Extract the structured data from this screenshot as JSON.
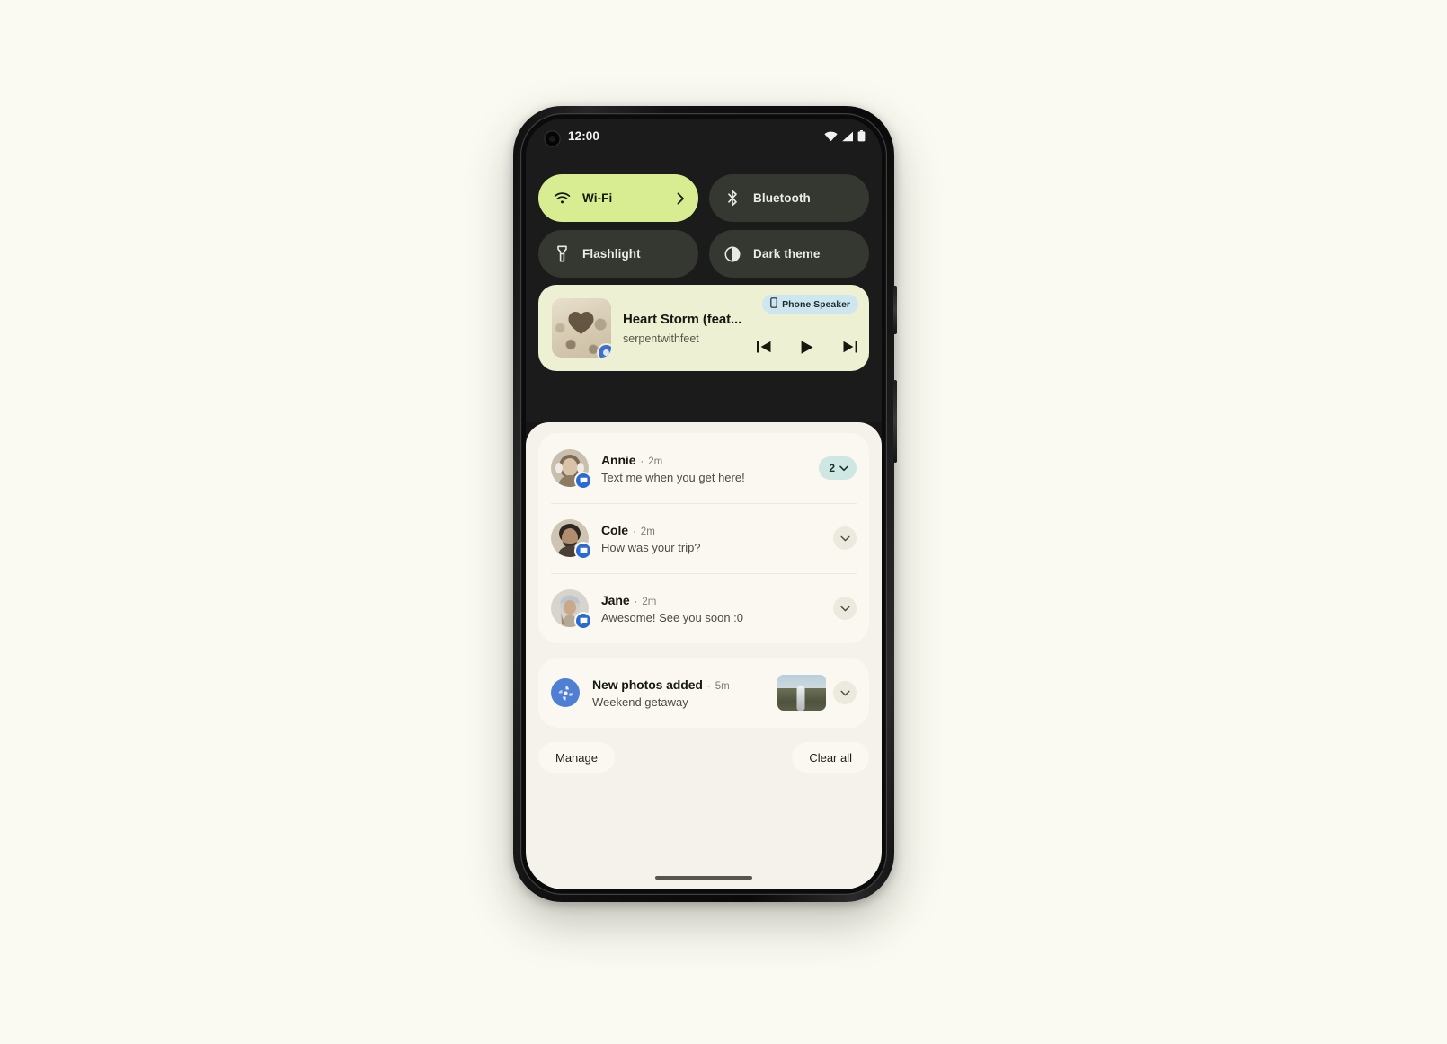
{
  "statusbar": {
    "clock": "12:00",
    "icons": [
      "wifi-icon",
      "cell-signal-icon",
      "battery-icon"
    ]
  },
  "quick_settings": {
    "tiles": [
      {
        "label": "Wi-Fi",
        "icon": "wifi-icon",
        "active": true,
        "has_chevron": true
      },
      {
        "label": "Bluetooth",
        "icon": "bluetooth-icon",
        "active": false,
        "has_chevron": false
      },
      {
        "label": "Flashlight",
        "icon": "flashlight-icon",
        "active": false,
        "has_chevron": false
      },
      {
        "label": "Dark theme",
        "icon": "dark-theme-icon",
        "active": false,
        "has_chevron": false
      }
    ],
    "active_color": "#d8ed92",
    "inactive_color": "#343831"
  },
  "media_player": {
    "title": "Heart Storm (feat...",
    "artist": "serpentwithfeet",
    "output_chip": {
      "label": "Phone Speaker",
      "icon": "phone-icon",
      "color": "#cde6ef"
    },
    "controls": [
      {
        "name": "previous-track",
        "icon": "skip-previous-icon"
      },
      {
        "name": "play",
        "icon": "play-icon"
      },
      {
        "name": "next-track",
        "icon": "skip-next-icon"
      }
    ],
    "album_art": "album-art-heart-storm",
    "card_color": "#eef0d3"
  },
  "notifications": [
    {
      "name": "Annie",
      "separator": "·",
      "time": "2m",
      "message": "Text me when you get here!",
      "app_badge": "messages-icon",
      "count": "2",
      "has_count_pill": true
    },
    {
      "name": "Cole",
      "separator": "·",
      "time": "2m",
      "message": "How was your trip?",
      "app_badge": "messages-icon",
      "count": null,
      "has_count_pill": false
    },
    {
      "name": "Jane",
      "separator": "·",
      "time": "2m",
      "message": "Awesome! See you soon :0",
      "app_badge": "messages-icon",
      "count": null,
      "has_count_pill": false
    }
  ],
  "photos_notification": {
    "title": "New photos added",
    "separator": "·",
    "time": "5m",
    "subtitle": "Weekend getaway",
    "app_icon": "google-photos-icon",
    "thumbnail": "waterfall-photo-thumbnail"
  },
  "shade_actions": {
    "manage": "Manage",
    "clear_all": "Clear all"
  },
  "navigation": {
    "gesture_pill": "home-gesture-pill"
  }
}
